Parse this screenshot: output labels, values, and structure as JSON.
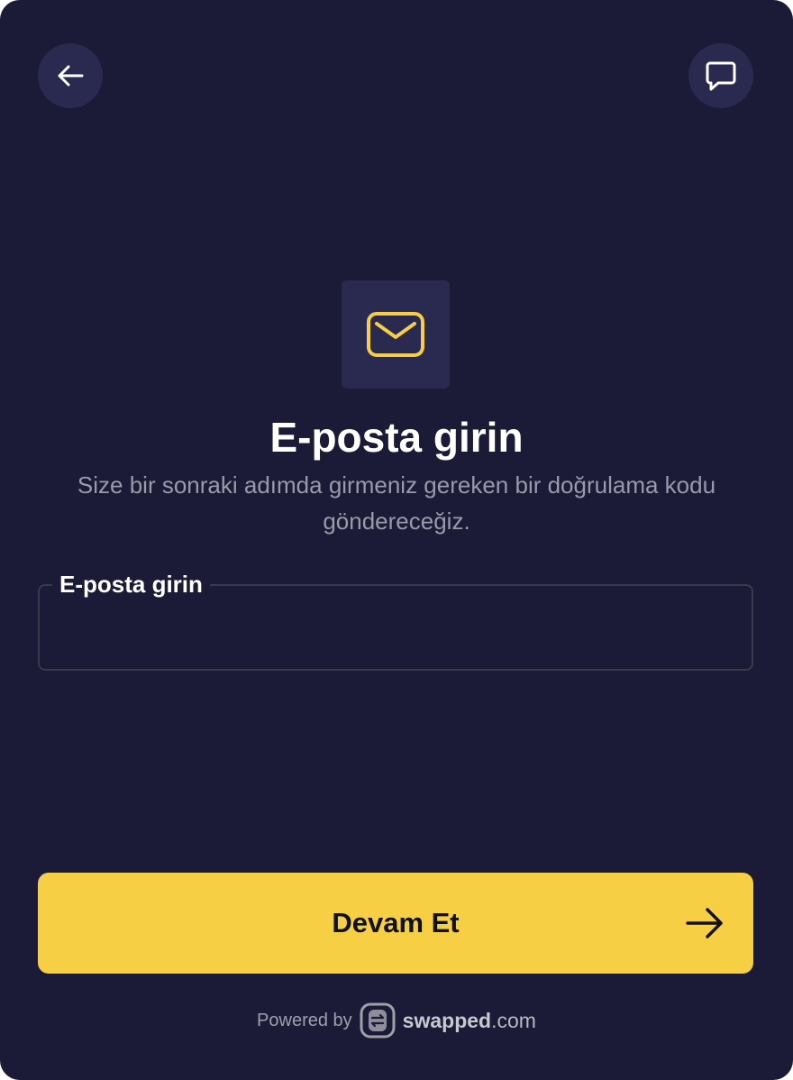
{
  "header": {
    "back_icon": "arrow-left-icon",
    "chat_icon": "chat-bubble-icon"
  },
  "hero": {
    "icon": "envelope-icon",
    "icon_color": "#f7cf45",
    "title": "E-posta girin",
    "subtitle": "Size bir sonraki adımda girmeniz gereken bir doğrulama kodu göndereceğiz."
  },
  "email_field": {
    "label": "E-posta girin",
    "value": ""
  },
  "continue_button": {
    "label": "Devam Et",
    "icon": "arrow-right-icon"
  },
  "footer": {
    "powered_by": "Powered by",
    "brand_name": "swapped",
    "brand_suffix": ".com",
    "logo_icon": "swap-logo-icon"
  },
  "colors": {
    "background": "#1b1a37",
    "accent": "#f7cf45",
    "surface": "#2a2950"
  }
}
